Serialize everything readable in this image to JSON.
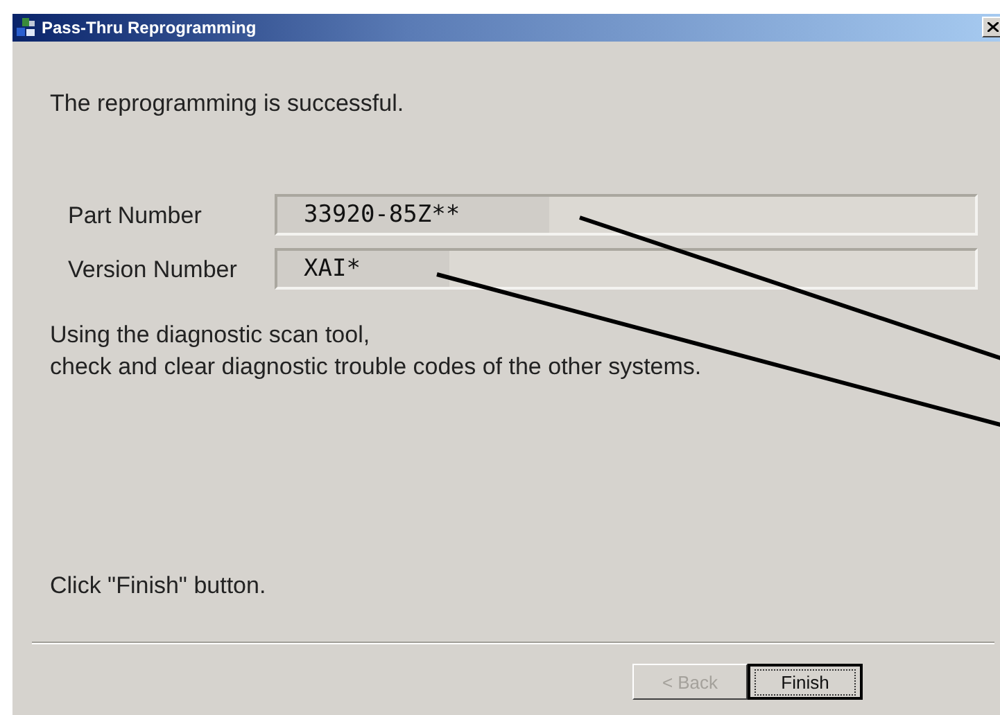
{
  "window": {
    "title": "Pass-Thru Reprogramming"
  },
  "message": "The reprogramming is successful.",
  "fields": [
    {
      "label": "Part Number",
      "value": "33920-85Z**"
    },
    {
      "label": "Version Number",
      "value": "XAI*"
    }
  ],
  "instructions": [
    "Using the diagnostic scan tool,",
    "check and clear diagnostic trouble codes of the other systems."
  ],
  "prompt": "Click \"Finish\" button.",
  "buttons": [
    {
      "label": "< Back",
      "disabled": true,
      "default": false
    },
    {
      "label": "Finish",
      "disabled": false,
      "default": true
    }
  ]
}
